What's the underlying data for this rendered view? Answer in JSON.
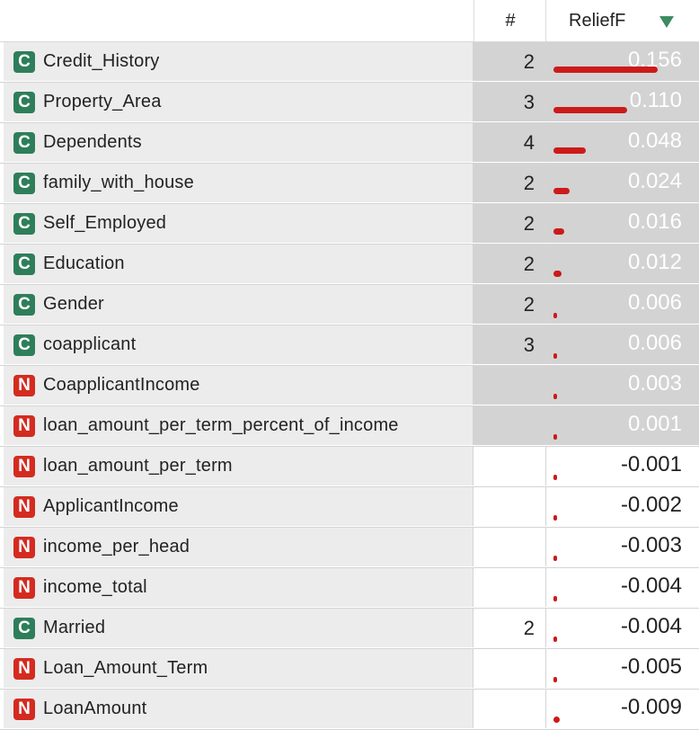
{
  "header": {
    "num_label": "#",
    "score_label": "ReliefF",
    "sort_icon": "sort-descending-icon",
    "sort_color": "#3e8c62"
  },
  "colors": {
    "categorical": "#2e7e5a",
    "numeric": "#d42b20",
    "bar": "#cc1a1a",
    "selected_bg": "#d3d3d3"
  },
  "rows": [
    {
      "type": "C",
      "name": "Credit_History",
      "num": "2",
      "value": "0.156",
      "score": 0.156,
      "selected": true
    },
    {
      "type": "C",
      "name": "Property_Area",
      "num": "3",
      "value": "0.110",
      "score": 0.11,
      "selected": true
    },
    {
      "type": "C",
      "name": "Dependents",
      "num": "4",
      "value": "0.048",
      "score": 0.048,
      "selected": true
    },
    {
      "type": "C",
      "name": "family_with_house",
      "num": "2",
      "value": "0.024",
      "score": 0.024,
      "selected": true
    },
    {
      "type": "C",
      "name": "Self_Employed",
      "num": "2",
      "value": "0.016",
      "score": 0.016,
      "selected": true
    },
    {
      "type": "C",
      "name": "Education",
      "num": "2",
      "value": "0.012",
      "score": 0.012,
      "selected": true
    },
    {
      "type": "C",
      "name": "Gender",
      "num": "2",
      "value": "0.006",
      "score": 0.006,
      "selected": true
    },
    {
      "type": "C",
      "name": "coapplicant",
      "num": "3",
      "value": "0.006",
      "score": 0.006,
      "selected": true
    },
    {
      "type": "N",
      "name": "CoapplicantIncome",
      "num": "",
      "value": "0.003",
      "score": 0.003,
      "selected": true
    },
    {
      "type": "N",
      "name": "loan_amount_per_term_percent_of_income",
      "num": "",
      "value": "0.001",
      "score": 0.001,
      "selected": true
    },
    {
      "type": "N",
      "name": "loan_amount_per_term",
      "num": "",
      "value": "-0.001",
      "score": -0.001,
      "selected": false
    },
    {
      "type": "N",
      "name": "ApplicantIncome",
      "num": "",
      "value": "-0.002",
      "score": -0.002,
      "selected": false
    },
    {
      "type": "N",
      "name": "income_per_head",
      "num": "",
      "value": "-0.003",
      "score": -0.003,
      "selected": false
    },
    {
      "type": "N",
      "name": "income_total",
      "num": "",
      "value": "-0.004",
      "score": -0.004,
      "selected": false
    },
    {
      "type": "C",
      "name": "Married",
      "num": "2",
      "value": "-0.004",
      "score": -0.004,
      "selected": false
    },
    {
      "type": "N",
      "name": "Loan_Amount_Term",
      "num": "",
      "value": "-0.005",
      "score": -0.005,
      "selected": false
    },
    {
      "type": "N",
      "name": "LoanAmount",
      "num": "",
      "value": "-0.009",
      "score": -0.009,
      "selected": false
    }
  ]
}
